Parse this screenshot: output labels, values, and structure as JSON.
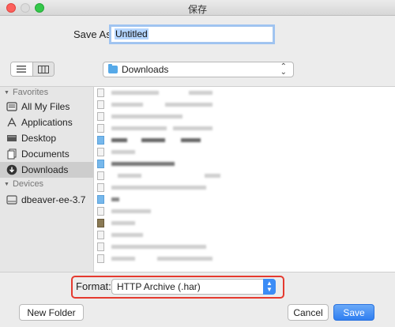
{
  "window": {
    "title": "保存"
  },
  "save_as": {
    "label": "Save As:",
    "value": "Untitled"
  },
  "toolbar": {
    "location": "Downloads"
  },
  "sidebar": {
    "favorites_header": "Favorites",
    "favorites": [
      {
        "label": "All My Files",
        "icon": "all-files-icon"
      },
      {
        "label": "Applications",
        "icon": "applications-icon"
      },
      {
        "label": "Desktop",
        "icon": "desktop-icon"
      },
      {
        "label": "Documents",
        "icon": "documents-icon"
      },
      {
        "label": "Downloads",
        "icon": "downloads-icon",
        "selected": true
      }
    ],
    "devices_header": "Devices",
    "devices": [
      {
        "label": "dbeaver-ee-3.7",
        "icon": "disk-icon"
      }
    ]
  },
  "footer": {
    "format_label": "Format:",
    "format_value": "HTTP Archive (.har)",
    "new_folder": "New Folder",
    "cancel": "Cancel",
    "save": "Save"
  },
  "colors": {
    "accent": "#3b8cf6",
    "highlight": "#e53a2f",
    "selected_row": "#cdcdcd"
  }
}
